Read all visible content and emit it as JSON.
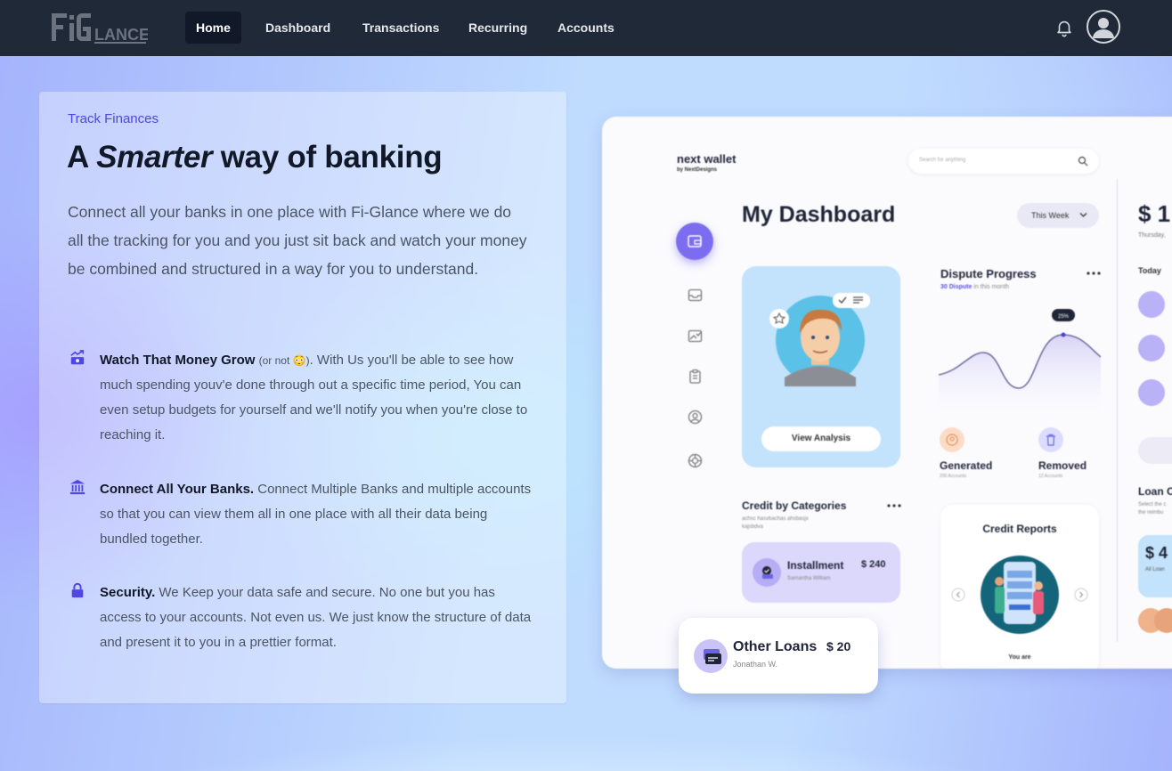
{
  "nav": {
    "logo_text": "FiGlance",
    "items": [
      "Home",
      "Dashboard",
      "Transactions",
      "Recurring",
      "Accounts"
    ],
    "active": "Home",
    "icons": [
      "bell-icon",
      "user-avatar-icon"
    ]
  },
  "hero": {
    "eyebrow": "Track Finances",
    "headline_pre": "A ",
    "headline_em": "Smarter",
    "headline_post": " way of banking",
    "lead": "Connect all your banks in one place with Fi-Glance where we do all the tracking for you and you just sit back and watch your money be combined and structured in a way for you to understand."
  },
  "features": [
    {
      "icon": "chart-money-icon",
      "title": "Watch That Money Grow",
      "aside": "(or not 😳)",
      "body": ". With Us you'll be able to see how much spending youv'e done through out a specific time period, You can even setup budgets for yourself and we'll notify you when you're close to reaching it."
    },
    {
      "icon": "bank-icon",
      "title": "Connect All Your Banks.",
      "aside": "",
      "body": " Connect Multiple Banks and multiple accounts so that you can view them all in one place with all their data being bundled together."
    },
    {
      "icon": "lock-icon",
      "title": "Security.",
      "aside": "",
      "body": " We Keep your data safe and secure. No one but you has access to your accounts. Not even us. We just know the structure of data and present it to you in a prettier format."
    }
  ],
  "mockup": {
    "brand": "next wallet",
    "brand_sub": "by NextDesigns",
    "search_placeholder": "Search for anything",
    "title": "My Dashboard",
    "period": "This Week",
    "balance": "$ 1",
    "balance_sub": "Thursday,",
    "today": "Today",
    "view_analysis": "View Analysis",
    "dispute_title": "Dispute Progress",
    "dispute_sub_strong": "30 Dispute",
    "dispute_sub_rest": " in this month",
    "dispute_badge": "25%",
    "generated": "Generated",
    "generated_sub": "200 Accounts",
    "removed": "Removed",
    "removed_sub": "12 Accounts",
    "credit_cat_title": "Credit by Categories",
    "credit_cat_sub1": "achsc hasvbachas ahsbasjx",
    "credit_cat_sub2": "kajsbdva",
    "installment": "Installment",
    "installment_name": "Samantha William",
    "installment_amount": "$ 240",
    "credit_reports": "Credit Reports",
    "you_are": "You are",
    "loan_title": "Loan C",
    "loan_sub1": "Select the c",
    "loan_sub2": "the reimbu",
    "loan_amount": "$ 4",
    "loan_amount_sub": "All Loan",
    "other_loans": "Other Loans",
    "other_loans_amount": "$ 20",
    "other_loans_name": "Jonathan W."
  }
}
